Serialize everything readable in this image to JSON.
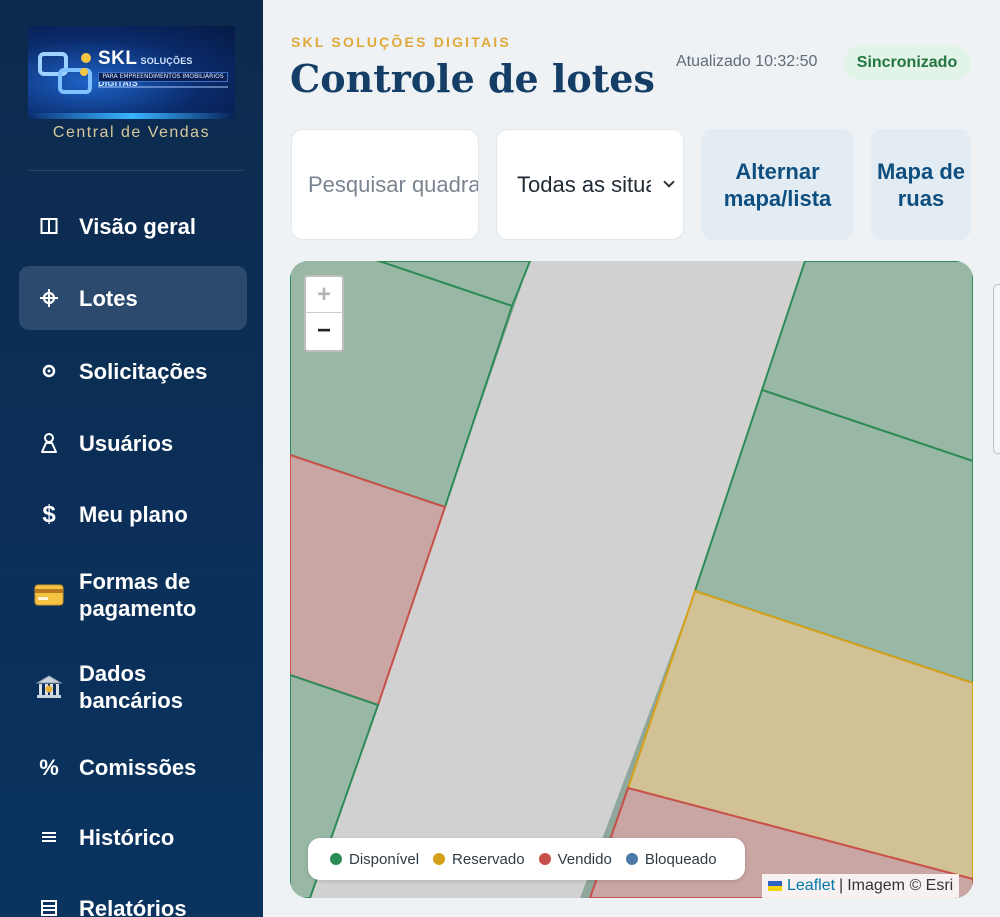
{
  "sidebar": {
    "logo": {
      "brand": "SKL",
      "brand_sub": "SOLUÇÕES DIGITAIS",
      "tagline": "PARA EMPREENDIMENTOS IMOBILIÁRIOS"
    },
    "caption": "Central de Vendas",
    "items": [
      {
        "label": "Visão geral",
        "icon": "layout-icon",
        "active": false
      },
      {
        "label": "Lotes",
        "icon": "crosshair-icon",
        "active": true
      },
      {
        "label": "Solicitações",
        "icon": "dot-circle-icon",
        "active": false
      },
      {
        "label": "Usuários",
        "icon": "user-icon",
        "active": false
      },
      {
        "label": "Meu plano",
        "icon": "dollar-icon",
        "active": false
      },
      {
        "label": "Formas de pagamento",
        "icon": "credit-card-icon",
        "active": false
      },
      {
        "label": "Dados bancários",
        "icon": "bank-icon",
        "active": false
      },
      {
        "label": "Comissões",
        "icon": "percent-icon",
        "active": false
      },
      {
        "label": "Histórico",
        "icon": "list-icon",
        "active": false
      },
      {
        "label": "Relatórios",
        "icon": "report-icon",
        "active": false
      }
    ]
  },
  "header": {
    "kicker": "SKL SOLUÇÕES DIGITAIS",
    "title": "Controle de lotes",
    "updated": "Atualizado 10:32:50",
    "status": "Sincronizado"
  },
  "controls": {
    "search_placeholder": "Pesquisar quadra ou lote",
    "status_select": "Todas as situações",
    "toggle_view": "Alternar mapa/lista",
    "street_map": "Mapa de ruas"
  },
  "map": {
    "zoom_in": "+",
    "zoom_out": "−",
    "legend": [
      {
        "label": "Disponível",
        "color": "#2e8b57"
      },
      {
        "label": "Reservado",
        "color": "#d4a017"
      },
      {
        "label": "Vendido",
        "color": "#c8504a"
      },
      {
        "label": "Bloqueado",
        "color": "#4a7aa8"
      }
    ],
    "attribution": {
      "leaflet": "Leaflet",
      "separator": "|",
      "imagery": "Imagem © Esri"
    }
  },
  "colors": {
    "available_fill": "#98b8a5",
    "reserved_fill": "#d3c196",
    "sold_fill": "#c9a5a3",
    "street_fill": "#d1d1d1"
  }
}
